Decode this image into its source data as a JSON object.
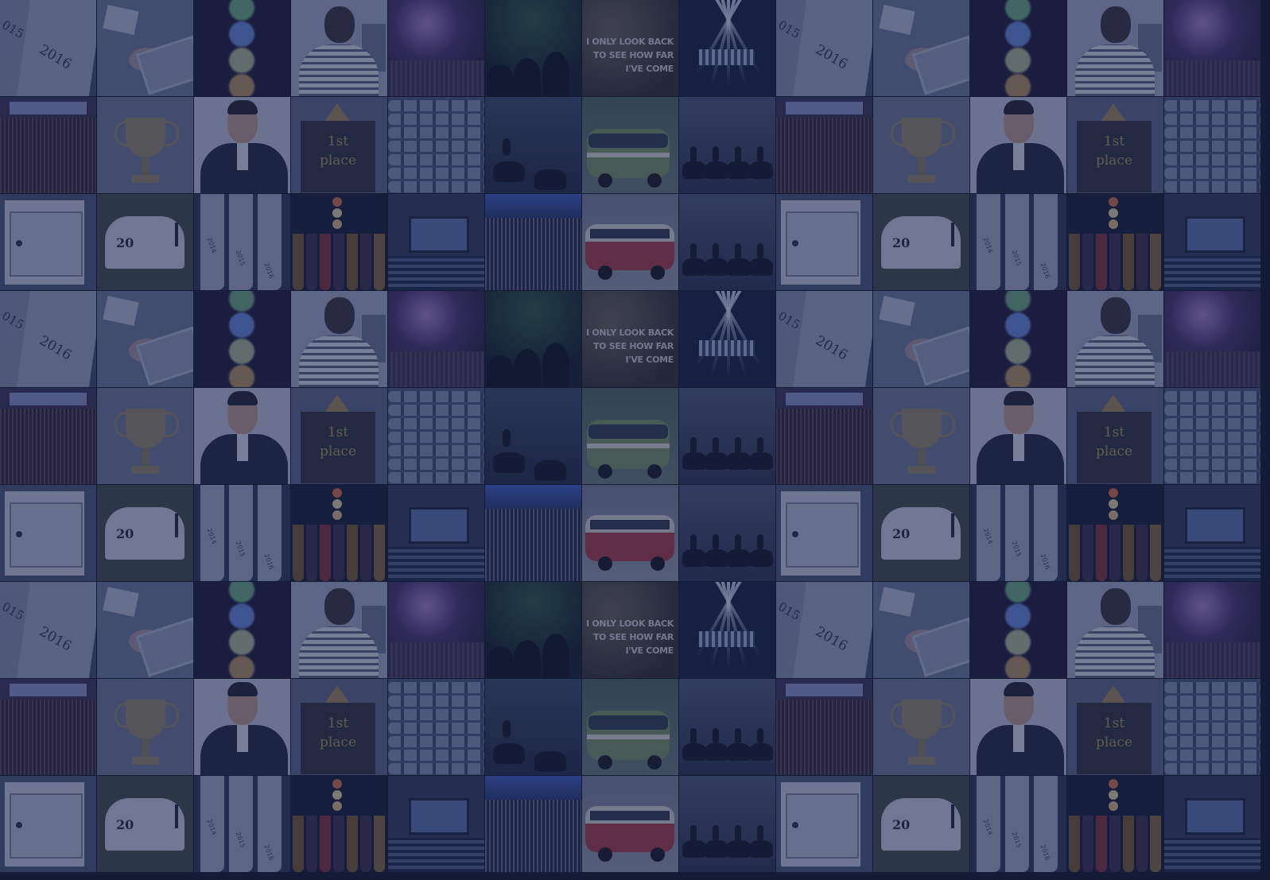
{
  "grid": {
    "columns": 13,
    "rows": 9
  },
  "tile_sequence": [
    [
      "calendar",
      "desk",
      "bokeh",
      "person",
      "concert",
      "silhouette",
      "quote",
      "stage",
      "calendar",
      "desk",
      "bokeh",
      "person",
      "concert"
    ],
    [
      "audience",
      "trophy",
      "portrait",
      "firstplace",
      "seats",
      "horses",
      "van",
      "riders",
      "audience",
      "trophy",
      "portrait",
      "firstplace",
      "seats"
    ],
    [
      "whitebox",
      "mailbox",
      "calstack",
      "theatre",
      "auditorium",
      "crowdblue",
      "redvan",
      "riders",
      "whitebox",
      "mailbox",
      "calstack",
      "theatre",
      "auditorium"
    ]
  ],
  "texts": {
    "calendar_year_a": "015",
    "calendar_year_b": "2016",
    "quote_lines": "I ONLY LOOK BACK\nTO SEE HOW FAR\nI'VE COME",
    "first_place": "1st\nplace",
    "mailbox_number": "20",
    "calstack_years": [
      "2014",
      "2015",
      "2016"
    ]
  },
  "colors": {
    "overlay": "#1b2650",
    "bokeh_dots": [
      "#7fd08a",
      "#7aa4ff",
      "#cfe3a0",
      "#e0b060"
    ],
    "theatre_lights": [
      "#e07040",
      "#f0e0a0",
      "#e8c080"
    ],
    "theatre_drapes": [
      "#7a5a20",
      "#3a2a40",
      "#8a2a2a",
      "#3a2a40",
      "#7a5a20",
      "#3a2a40",
      "#8a6a2a"
    ],
    "van_body": "#7e9a5c"
  }
}
